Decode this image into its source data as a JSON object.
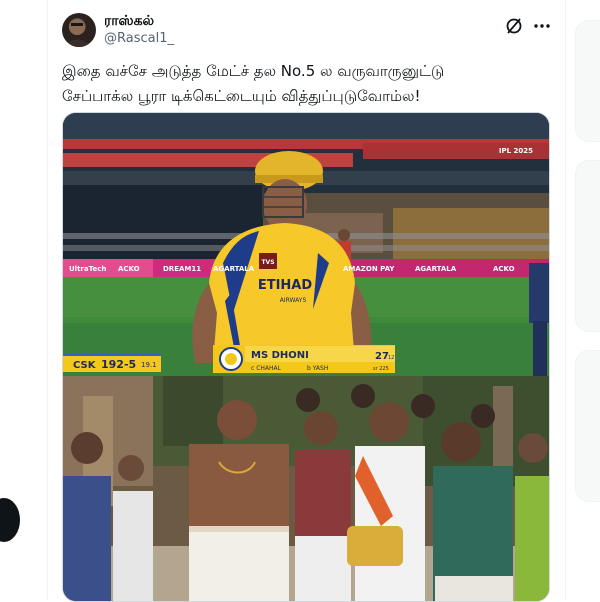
{
  "post": {
    "display_name": "ராஸ்கல்",
    "handle": "@Rascal1_",
    "text_lines": [
      "இதை வச்சே அடுத்த மேட்ச் தல No.5 ல வருவாருனுட்டு",
      "சேப்பாக்ல பூரா டிக்கெட்டையும் வித்துப்புடுவோம்ல!"
    ]
  },
  "icons": {
    "grok": "grok-icon",
    "more": "more-options-icon"
  },
  "media": {
    "frame1": {
      "stadium_banner": "IPL 2025",
      "ad_board": [
        "UltraTech",
        "ACKO",
        "DREAM11",
        "AGARTALA",
        "AMAZON PAY",
        "AGARTALA",
        "ACKO"
      ],
      "jersey_sponsor": "ETIHAD",
      "jersey_sponsor_sub": "AIRWAYS",
      "jersey_brand": "TVS",
      "scorebug": {
        "team": "CSK",
        "score": "192-5",
        "overs": "19.1",
        "batter": "MS DHONI",
        "batter_runs": "27",
        "batter_balls": "12",
        "bowler": "c CHAHAL",
        "other": "b YASH",
        "extra": "sr 225"
      }
    }
  },
  "colors": {
    "csk_yellow": "#f7c82a",
    "scorebug_yellow": "#f3c81a",
    "pitch_green": "#3d8a3a",
    "text_primary": "#0f1419",
    "text_secondary": "#536471"
  }
}
